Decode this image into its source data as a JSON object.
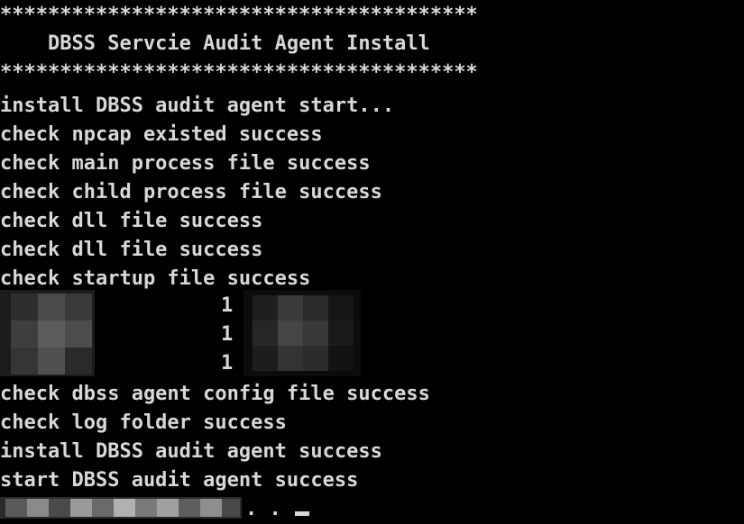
{
  "console": {
    "header_border_top": "****************************************",
    "header_title": "    DBSS Servcie Audit Agent Install",
    "header_border_bottom": "****************************************",
    "log_lines": [
      "install DBSS audit agent start...",
      "check npcap existed success",
      "check main process file success",
      "check child process file success",
      "check dll file success",
      "check dll file success",
      "check startup file success"
    ],
    "redacted_rows": [
      "1",
      "1",
      "1"
    ],
    "log_lines_after": [
      "check dbss agent config file success",
      "check log folder success",
      "install DBSS audit agent success",
      "start DBSS audit agent success"
    ],
    "final_prompt_tail": ". ."
  },
  "colors": {
    "background": "#000000",
    "text": "#d8d8d8"
  }
}
